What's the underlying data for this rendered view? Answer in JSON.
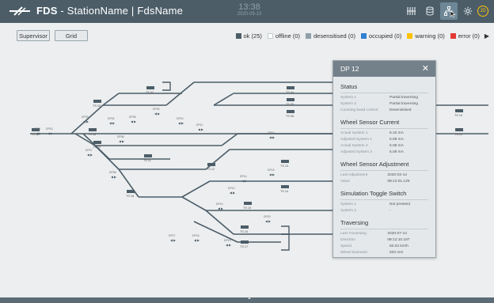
{
  "header": {
    "brand": "FDS",
    "title": "StationName | FdsName",
    "separator": "-",
    "time": "13:38",
    "date": "2020-09-13",
    "user_initials": "JD"
  },
  "toolbar": {
    "supervisor_label": "Supervisor",
    "grid_label": "Grid"
  },
  "legend": [
    {
      "label": "ok (25)",
      "color": "#4c5d68"
    },
    {
      "label": "offline (0)",
      "color": "#ffffff"
    },
    {
      "label": "desensitised (0)",
      "color": "#8fa0ab"
    },
    {
      "label": "occupied (0)",
      "color": "#2f7fd3"
    },
    {
      "label": "warning (0)",
      "color": "#ffc107"
    },
    {
      "label": "error (0)",
      "color": "#e53935"
    }
  ],
  "track": {
    "track_color": "#4c5d68",
    "labels": [
      {
        "text": "TS 02"
      },
      {
        "text": "TS 03"
      },
      {
        "text": "TS 04"
      },
      {
        "text": "TS 05"
      },
      {
        "text": "TS 06"
      },
      {
        "text": "TS 08"
      },
      {
        "text": "TS 09"
      },
      {
        "text": "TS 10"
      },
      {
        "text": "TS 11"
      },
      {
        "text": "TS 12"
      },
      {
        "text": "TS 13"
      },
      {
        "text": "TS 14"
      },
      {
        "text": "TS 15"
      },
      {
        "text": "TS 16"
      },
      {
        "text": "TS 17"
      },
      {
        "text": "TS 18"
      },
      {
        "text": "TS 19"
      },
      {
        "text": "TS 20"
      }
    ],
    "points": [
      {
        "text": "DP01"
      },
      {
        "text": "DP02"
      },
      {
        "text": "DP03"
      },
      {
        "text": "DP04"
      },
      {
        "text": "DP05"
      },
      {
        "text": "DP06"
      },
      {
        "text": "DP07"
      },
      {
        "text": "DP08"
      },
      {
        "text": "DP09"
      },
      {
        "text": "DP10"
      },
      {
        "text": "DP11"
      },
      {
        "text": "DP12"
      },
      {
        "text": "DP13"
      },
      {
        "text": "DP14"
      },
      {
        "text": "DP15"
      },
      {
        "text": "DP16"
      },
      {
        "text": "DP17"
      },
      {
        "text": "DP18"
      },
      {
        "text": "DP19"
      },
      {
        "text": "DP20"
      }
    ]
  },
  "panel": {
    "title": "DP 12",
    "sections": [
      {
        "title": "Status",
        "rows": [
          {
            "label": "System 1",
            "value": "Partial traversing"
          },
          {
            "label": "System 2",
            "value": "Partial traversing"
          },
          {
            "label": "Counting head control",
            "value": "Desensitised"
          }
        ]
      },
      {
        "title": "Wheel Sensor Current",
        "rows": [
          {
            "label": "Actual System 1",
            "value": "5.10 mA"
          },
          {
            "label": "Adjusted System 1",
            "value": "5.08 mA"
          },
          {
            "label": "Actual System 2",
            "value": "5.08 mA"
          },
          {
            "label": "Adjusted System 2",
            "value": "5.08 mA"
          }
        ]
      },
      {
        "title": "Wheel Sensor Adjustment",
        "rows": [
          {
            "label": "Last Adjustment",
            "value": "2020-02-14 08:12:01.125"
          },
          {
            "label": "Value",
            "value": "-"
          }
        ]
      },
      {
        "title": "Simulation Toggle Switch",
        "rows": [
          {
            "label": "System 1",
            "value": "Not pressed"
          },
          {
            "label": "System 2",
            "value": "-"
          }
        ]
      },
      {
        "title": "Traversing",
        "rows": [
          {
            "label": "Last Traversing",
            "value": "2020-07-14 08:12:10.187"
          },
          {
            "label": "Direction",
            "value": "-"
          },
          {
            "label": "Speed",
            "value": "50.02 km/h"
          },
          {
            "label": "Wheel Diameter",
            "value": "520 mm"
          }
        ]
      }
    ]
  }
}
